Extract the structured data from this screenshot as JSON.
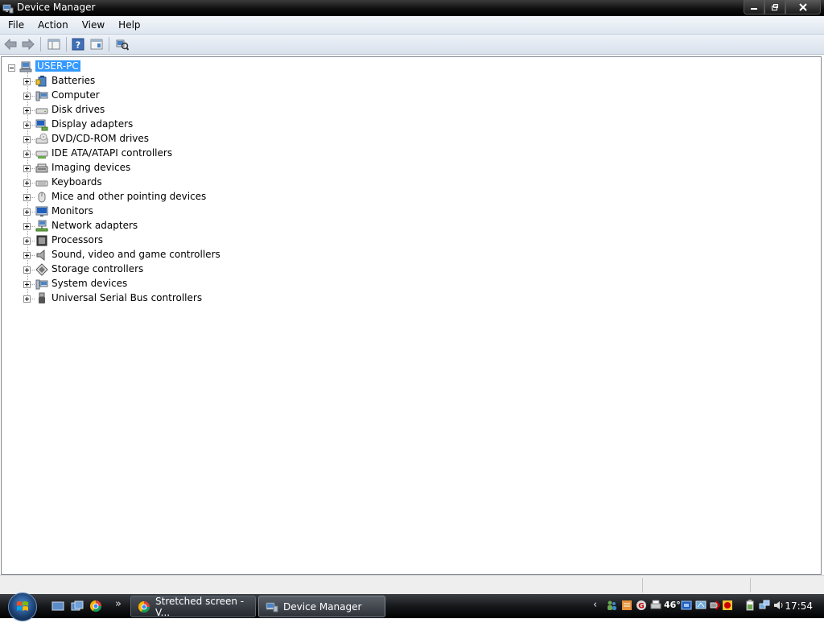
{
  "window": {
    "title": "Device Manager"
  },
  "menu": [
    "File",
    "Action",
    "View",
    "Help"
  ],
  "tree": {
    "root": "USER-PC",
    "items": [
      {
        "label": "Batteries",
        "icon": "battery-icon"
      },
      {
        "label": "Computer",
        "icon": "computer-icon"
      },
      {
        "label": "Disk drives",
        "icon": "disk-drive-icon"
      },
      {
        "label": "Display adapters",
        "icon": "display-adapter-icon"
      },
      {
        "label": "DVD/CD-ROM drives",
        "icon": "dvd-drive-icon"
      },
      {
        "label": "IDE ATA/ATAPI controllers",
        "icon": "ide-controller-icon"
      },
      {
        "label": "Imaging devices",
        "icon": "imaging-device-icon"
      },
      {
        "label": "Keyboards",
        "icon": "keyboard-icon"
      },
      {
        "label": "Mice and other pointing devices",
        "icon": "mouse-icon"
      },
      {
        "label": "Monitors",
        "icon": "monitor-icon"
      },
      {
        "label": "Network adapters",
        "icon": "network-adapter-icon"
      },
      {
        "label": "Processors",
        "icon": "processor-icon"
      },
      {
        "label": "Sound, video and game controllers",
        "icon": "speaker-icon"
      },
      {
        "label": "Storage controllers",
        "icon": "storage-controller-icon"
      },
      {
        "label": "System devices",
        "icon": "system-device-icon"
      },
      {
        "label": "Universal Serial Bus controllers",
        "icon": "usb-icon"
      }
    ]
  },
  "taskbar": {
    "tasks": [
      {
        "label": "Stretched screen - V..."
      },
      {
        "label": "Device Manager"
      }
    ],
    "clock": "17:54",
    "tray_temp": "46°"
  }
}
